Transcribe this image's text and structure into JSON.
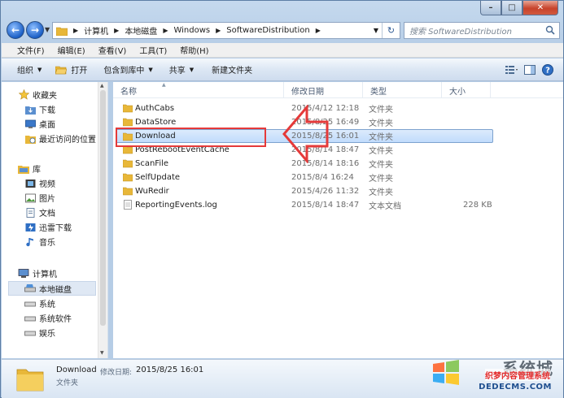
{
  "address": {
    "crumbs": [
      "计算机",
      "本地磁盘",
      "Windows",
      "SoftwareDistribution"
    ],
    "search_placeholder": "搜索 SoftwareDistribution"
  },
  "menu": [
    "文件(F)",
    "编辑(E)",
    "查看(V)",
    "工具(T)",
    "帮助(H)"
  ],
  "toolbar": {
    "organize": "组织",
    "open": "打开",
    "include": "包含到库中",
    "share": "共享",
    "new_folder": "新建文件夹"
  },
  "nav": {
    "favorites": "收藏夹",
    "downloads": "下载",
    "desktop": "桌面",
    "recent": "最近访问的位置",
    "libraries": "库",
    "videos": "视频",
    "pictures": "图片",
    "documents": "文档",
    "thunder": "迅雷下载",
    "music": "音乐",
    "computer": "计算机",
    "local_disk": "本地磁盘",
    "system": "系统",
    "software": "系统软件",
    "entertainment": "娱乐"
  },
  "columns": {
    "name": "名称",
    "modified": "修改日期",
    "type": "类型",
    "size": "大小"
  },
  "files": [
    {
      "name": "AuthCabs",
      "date": "2015/4/12 12:18",
      "type": "文件夹",
      "size": ""
    },
    {
      "name": "DataStore",
      "date": "2015/8/25 16:49",
      "type": "文件夹",
      "size": ""
    },
    {
      "name": "Download",
      "date": "2015/8/25 16:01",
      "type": "文件夹",
      "size": ""
    },
    {
      "name": "PostRebootEventCache",
      "date": "2015/8/14 18:47",
      "type": "文件夹",
      "size": ""
    },
    {
      "name": "ScanFile",
      "date": "2015/8/14 18:16",
      "type": "文件夹",
      "size": ""
    },
    {
      "name": "SelfUpdate",
      "date": "2015/8/4 16:24",
      "type": "文件夹",
      "size": ""
    },
    {
      "name": "WuRedir",
      "date": "2015/4/26 11:32",
      "type": "文件夹",
      "size": ""
    },
    {
      "name": "ReportingEvents.log",
      "date": "2015/8/14 18:47",
      "type": "文本文档",
      "size": "228 KB"
    }
  ],
  "details": {
    "name": "Download",
    "label": "修改日期:",
    "value": "2015/8/25 16:01",
    "type": "文件夹"
  },
  "watermark": {
    "top": "系统城",
    "mid": "织梦内容管理系统",
    "bot": "DEDECMS.COM"
  },
  "colors": {
    "folder": "#e8b739",
    "highlight": "#e53a3a",
    "selection": "#c1dcfc"
  }
}
